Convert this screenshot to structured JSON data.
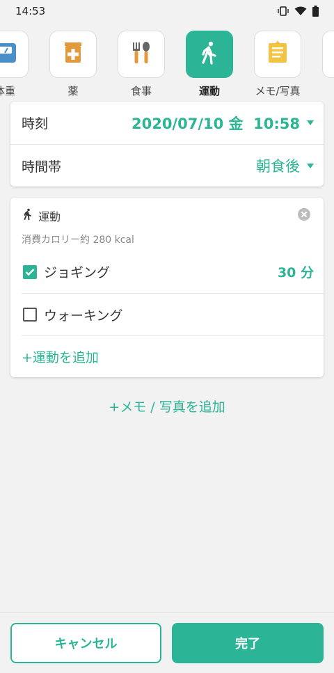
{
  "status": {
    "time": "14:53"
  },
  "categories": [
    {
      "label": "体重",
      "icon": "scale-icon"
    },
    {
      "label": "薬",
      "icon": "medicine-box-icon"
    },
    {
      "label": "食事",
      "icon": "fork-spoon-icon"
    },
    {
      "label": "運動",
      "icon": "walking-icon",
      "active": true
    },
    {
      "label": "メモ/写真",
      "icon": "memo-icon"
    }
  ],
  "time_card": {
    "time_label": "時刻",
    "time_value": "2020/07/10 金  10:58",
    "period_label": "時間帯",
    "period_value": "朝食後"
  },
  "exercise": {
    "title": "運動",
    "calories": "消費カロリー約 280 kcal",
    "items": [
      {
        "label": "ジョギング",
        "checked": true,
        "duration": "30 分"
      },
      {
        "label": "ウォーキング",
        "checked": false,
        "duration": ""
      }
    ],
    "add_label": "+運動を追加"
  },
  "add_memo_label": "+メモ / 写真を追加",
  "buttons": {
    "cancel": "キャンセル",
    "done": "完了"
  },
  "colors": {
    "accent": "#2bb596",
    "background": "#f2f2f2"
  }
}
